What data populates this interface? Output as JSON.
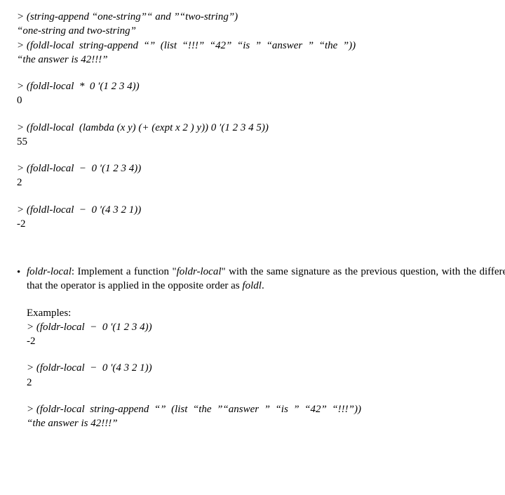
{
  "top": {
    "ex1": {
      "in": "> (string-append “one-string”“ and ”“two-string”)",
      "out": "“one-string and two-string”"
    },
    "ex2": {
      "in": "> (foldl-local  string-append  “”  (list  “!!!”  “42”  “is  ”  “answer  ”  “the  ”))",
      "out": "“the answer is 42!!!”"
    },
    "ex3": {
      "in": "> (foldl-local  *  0 ′(1 2 3 4))",
      "out": "0"
    },
    "ex4": {
      "in": "> (foldl-local  (lambda (x y) (+ (expt x 2 ) y)) 0 ′(1 2 3 4 5))",
      "out": "55"
    },
    "ex5": {
      "in": "> (foldl-local  −  0 ′(1 2 3 4))",
      "out": "2"
    },
    "ex6": {
      "in": "> (foldl-local  −  0 ′(4 3 2 1))",
      "out": "-2"
    }
  },
  "bullet": {
    "name": "foldr-local",
    "desc_prefix": ":  Implement a function \"",
    "desc_mid": "\" with the same signature as the previous question, with the difference that the operator is applied in the opposite order as ",
    "desc_tail": ".",
    "foldl_word": "foldl",
    "examples_label": "Examples:"
  },
  "bottom": {
    "ex1": {
      "in": "> (foldr-local  −  0 ′(1 2 3 4))",
      "out": "-2"
    },
    "ex2": {
      "in": "> (foldr-local  −  0 ′(4 3 2 1))",
      "out": "2"
    },
    "ex3": {
      "in": "> (foldr-local  string-append  “”  (list  “the  ”“answer  ”  “is  ”  “42”  “!!!”))",
      "out": "“the answer is 42!!!”"
    }
  }
}
